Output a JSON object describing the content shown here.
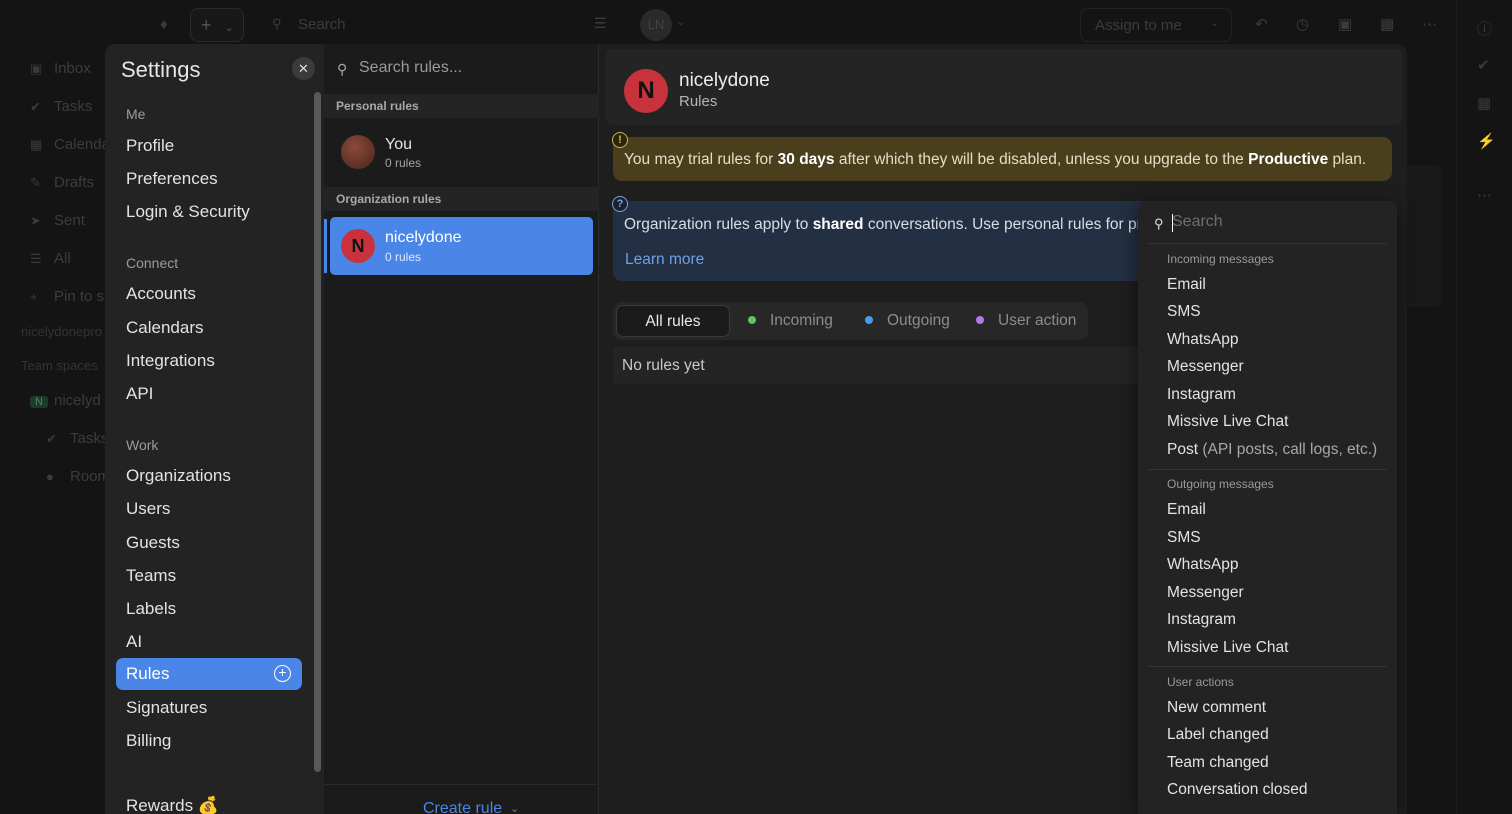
{
  "background": {
    "topbar": {
      "search_placeholder": "Search",
      "avatar_initials": "LN",
      "assign_label": "Assign to me"
    },
    "nav": {
      "inbox": "Inbox",
      "tasks": "Tasks",
      "calendar": "Calenda",
      "drafts": "Drafts",
      "sent": "Sent",
      "all": "All",
      "pin": "Pin to s",
      "account_email": "nicelydonepro",
      "team_spaces": "Team spaces",
      "team_name": "nicelyd",
      "team_initial": "N",
      "team_tasks": "Tasks",
      "team_rooms": "Room"
    }
  },
  "settings": {
    "title": "Settings",
    "sections": {
      "me": "Me",
      "connect": "Connect",
      "work": "Work"
    },
    "items": {
      "profile": "Profile",
      "preferences": "Preferences",
      "login_security": "Login & Security",
      "accounts": "Accounts",
      "calendars": "Calendars",
      "integrations": "Integrations",
      "api": "API",
      "organizations": "Organizations",
      "users": "Users",
      "guests": "Guests",
      "teams": "Teams",
      "labels": "Labels",
      "ai": "AI",
      "rules": "Rules",
      "signatures": "Signatures",
      "billing": "Billing",
      "rewards": "Rewards 💰"
    }
  },
  "rules_list": {
    "search_placeholder": "Search rules...",
    "personal_header": "Personal rules",
    "organization_header": "Organization rules",
    "personal": {
      "name": "You",
      "count": "0 rules"
    },
    "organization": {
      "name": "nicelydone",
      "initial": "N",
      "count": "0 rules"
    },
    "create_label": "Create rule"
  },
  "rules_main": {
    "avatar_initial": "N",
    "title": "nicelydone",
    "subtitle": "Rules",
    "warning": {
      "icon": "!",
      "pre": "You may trial rules for ",
      "days": "30 days",
      "mid": " after which they will be disabled, unless you upgrade to the ",
      "plan": "Productive",
      "post": " plan."
    },
    "info": {
      "icon": "?",
      "pre": "Organization rules apply to ",
      "shared": "shared",
      "post": " conversations. Use personal rules for priv",
      "learn_more": "Learn more"
    },
    "tabs": {
      "all": "All rules",
      "incoming": "Incoming",
      "outgoing": "Outgoing",
      "user_action": "User action"
    },
    "empty": "No rules yet"
  },
  "dropdown": {
    "search_placeholder": "Search",
    "incoming_header": "Incoming messages",
    "incoming": [
      "Email",
      "SMS",
      "WhatsApp",
      "Messenger",
      "Instagram",
      "Missive Live Chat"
    ],
    "post_label": "Post",
    "post_hint": "(API posts, call logs, etc.)",
    "outgoing_header": "Outgoing messages",
    "outgoing": [
      "Email",
      "SMS",
      "WhatsApp",
      "Messenger",
      "Instagram",
      "Missive Live Chat"
    ],
    "user_header": "User actions",
    "user_actions": [
      "New comment",
      "Label changed",
      "Team changed",
      "Conversation closed"
    ]
  },
  "colors": {
    "accent_blue": "#4a86e8",
    "org_avatar_red": "#c8323c",
    "incoming_dot": "#5ec46b",
    "outgoing_dot": "#4a9be8",
    "user_action_dot": "#b07ce8",
    "warning_bg": "#4a3f1d",
    "info_bg": "#233043"
  }
}
